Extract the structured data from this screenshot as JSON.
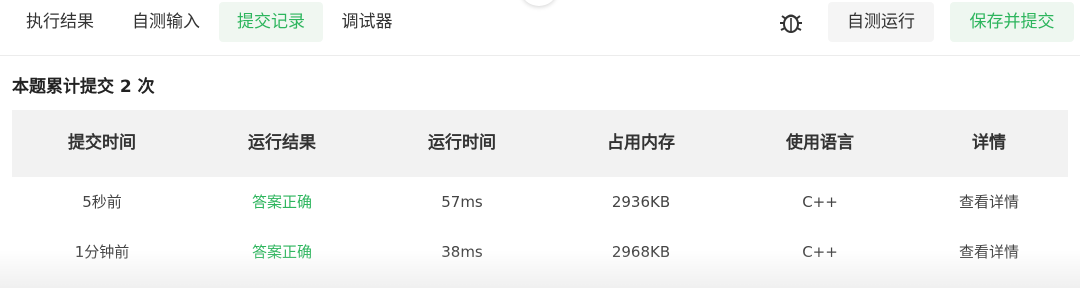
{
  "tabs": [
    {
      "label": "执行结果"
    },
    {
      "label": "自测输入"
    },
    {
      "label": "提交记录"
    },
    {
      "label": "调试器"
    }
  ],
  "actions": {
    "debug_icon": "bug-icon",
    "run_label": "自测运行",
    "save_label": "保存并提交"
  },
  "summary": "本题累计提交 2 次",
  "table": {
    "headers": [
      "提交时间",
      "运行结果",
      "运行时间",
      "占用内存",
      "使用语言",
      "详情"
    ],
    "rows": [
      [
        "5秒前",
        "答案正确",
        "57ms",
        "2936KB",
        "C++",
        "查看详情"
      ],
      [
        "1分钟前",
        "答案正确",
        "38ms",
        "2968KB",
        "C++",
        "查看详情"
      ]
    ]
  },
  "colors": {
    "accent": "#2db55d",
    "header_bg": "#f2f2f2"
  }
}
